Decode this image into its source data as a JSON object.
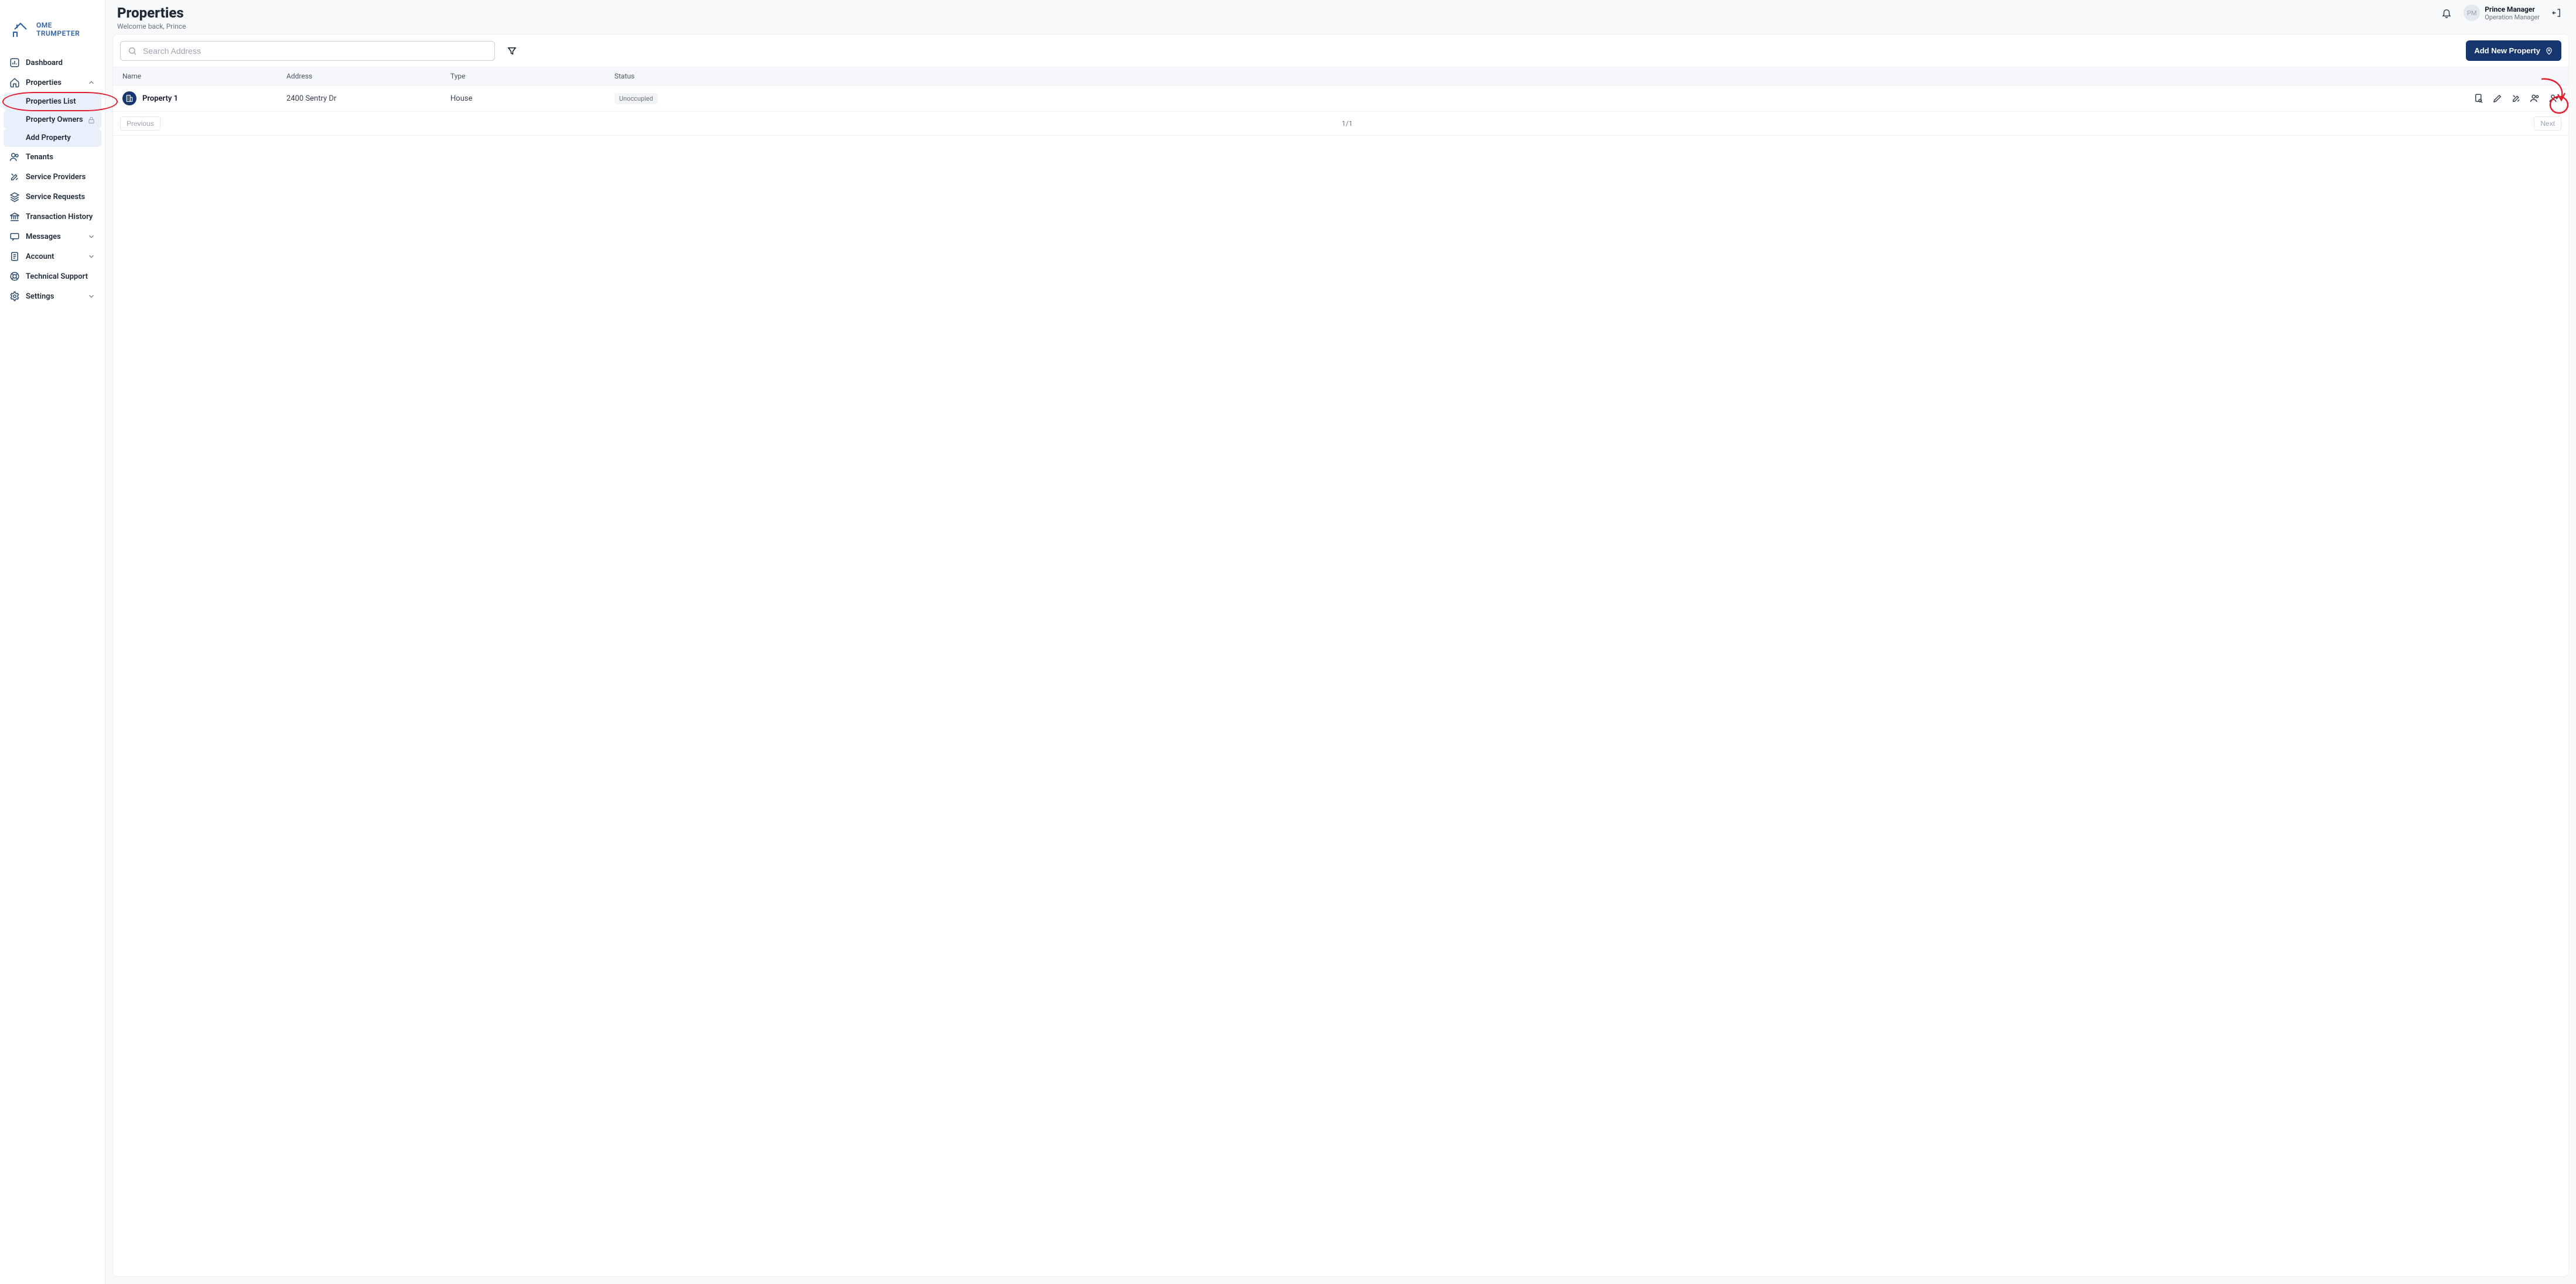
{
  "brand": "OME TRUMPETER",
  "sidebar": {
    "items": [
      {
        "label": "Dashboard"
      },
      {
        "label": "Properties",
        "expanded": true,
        "children": [
          {
            "label": "Properties List",
            "active": true
          },
          {
            "label": "Property Owners",
            "locked": true
          },
          {
            "label": "Add Property"
          }
        ]
      },
      {
        "label": "Tenants"
      },
      {
        "label": "Service Providers"
      },
      {
        "label": "Service Requests"
      },
      {
        "label": "Transaction History"
      },
      {
        "label": "Messages",
        "chevron": true
      },
      {
        "label": "Account",
        "chevron": true
      },
      {
        "label": "Technical Support"
      },
      {
        "label": "Settings",
        "chevron": true
      }
    ]
  },
  "header": {
    "title": "Properties",
    "subtitle": "Welcome back, Prince",
    "user": {
      "initials": "PM",
      "name": "Prince Manager",
      "role": "Operation Manager"
    }
  },
  "toolbar": {
    "search_placeholder": "Search Address",
    "add_button": "Add New Property"
  },
  "table": {
    "columns": [
      "Name",
      "Address",
      "Type",
      "Status"
    ],
    "rows": [
      {
        "name": "Property 1",
        "address": "2400 Sentry Dr",
        "type": "House",
        "status": "Unoccupied"
      }
    ]
  },
  "pager": {
    "prev": "Previous",
    "next": "Next",
    "page_label": "1/1"
  }
}
